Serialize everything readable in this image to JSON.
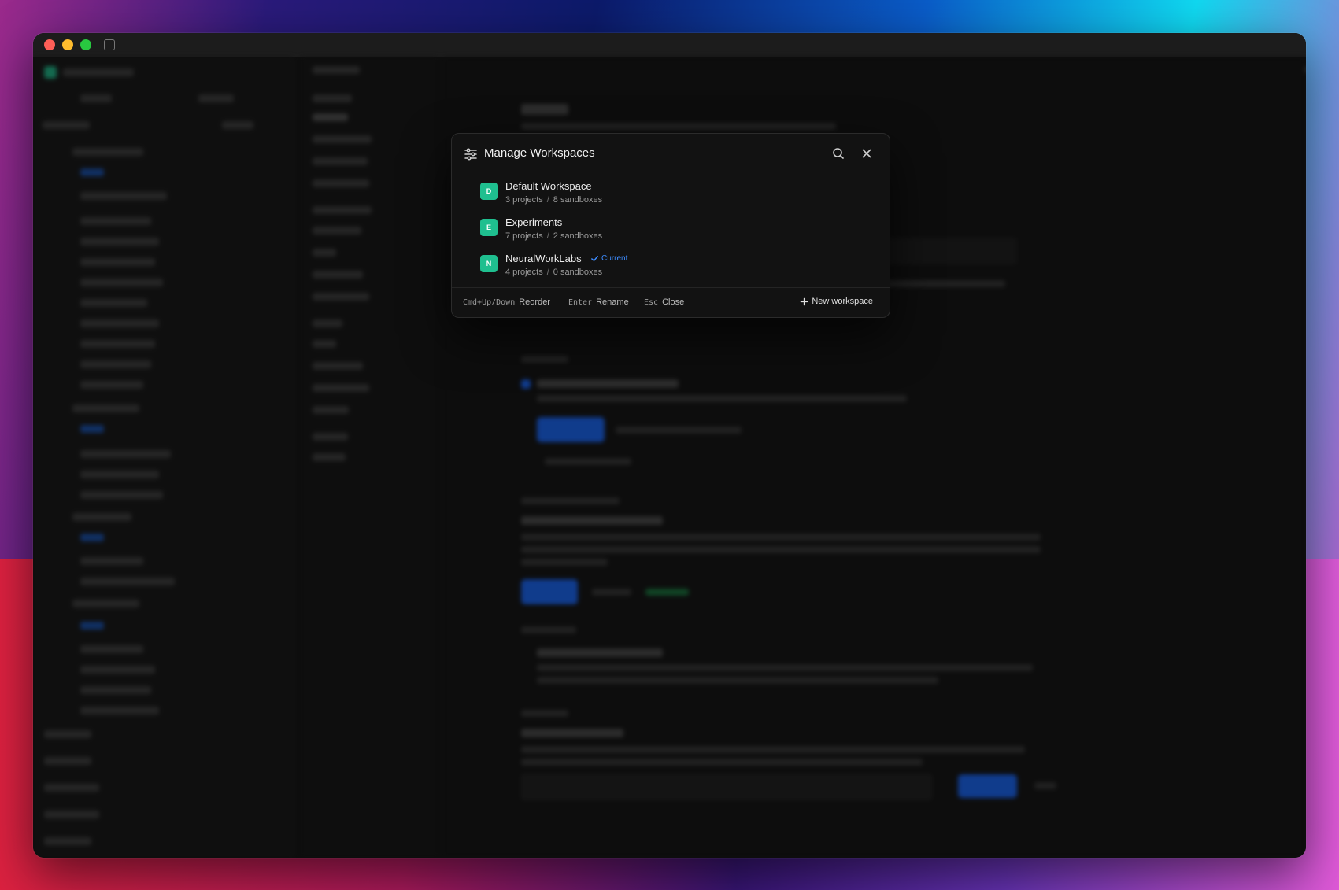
{
  "modal": {
    "title": "Manage Workspaces",
    "title_icon": "sliders-icon",
    "search_icon": "search-icon",
    "close_icon": "close-icon",
    "workspaces": [
      {
        "initial": "D",
        "name": "Default Workspace",
        "projects": "3 projects",
        "sandboxes": "8 sandboxes",
        "current": false
      },
      {
        "initial": "E",
        "name": "Experiments",
        "projects": "7 projects",
        "sandboxes": "2 sandboxes",
        "current": false
      },
      {
        "initial": "N",
        "name": "NeuralWorkLabs",
        "projects": "4 projects",
        "sandboxes": "0 sandboxes",
        "current": true,
        "current_label": "Current"
      }
    ],
    "separator": "/",
    "footer": {
      "reorder_key": "Cmd+Up/Down",
      "reorder_label": "Reorder",
      "rename_key": "Enter",
      "rename_label": "Rename",
      "close_key": "Esc",
      "close_label": "Close",
      "new_workspace_label": "New workspace"
    }
  },
  "colors": {
    "avatar": "#1fbf8f",
    "current": "#3d8cff",
    "modal_bg": "#121212"
  }
}
